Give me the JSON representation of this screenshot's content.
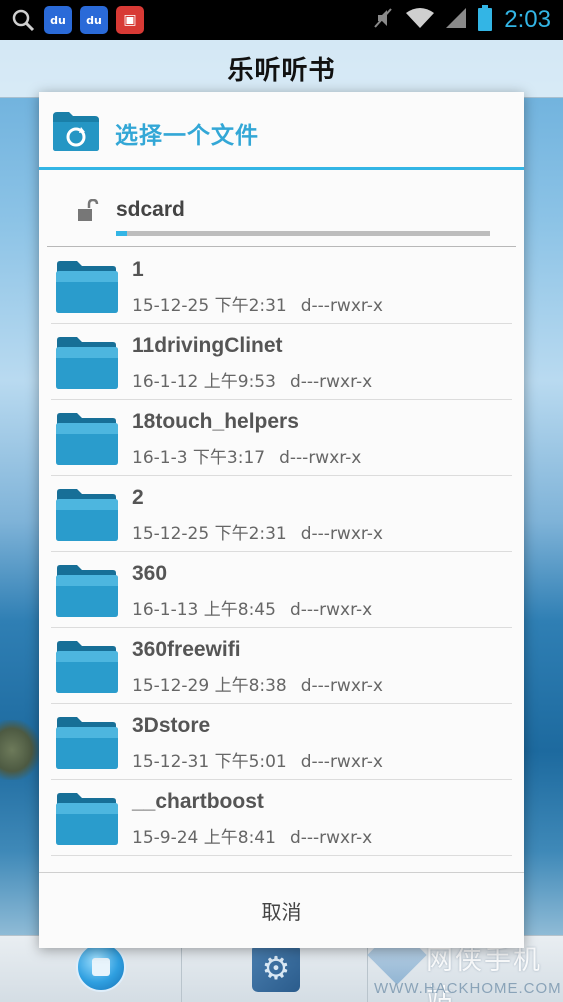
{
  "status_bar": {
    "time": "2:03",
    "left_icons": [
      "search-icon",
      "baidu-paw-icon",
      "baidu-paw-icon",
      "red-app-icon"
    ],
    "right_icons": [
      "mute-icon",
      "wifi-icon",
      "signal-icon",
      "battery-icon"
    ]
  },
  "app": {
    "title": "乐听听书"
  },
  "dialog": {
    "title": "选择一个文件",
    "path": "sdcard",
    "path_scroll_fraction": 0.03,
    "accent_color": "#33b5e5",
    "files": [
      {
        "name": "1",
        "date": "15-12-25 下午2:31",
        "perm": "d---rwxr-x"
      },
      {
        "name": "11drivingClinet",
        "date": "16-1-12 上午9:53",
        "perm": "d---rwxr-x"
      },
      {
        "name": "18touch_helpers",
        "date": "16-1-3 下午3:17",
        "perm": "d---rwxr-x"
      },
      {
        "name": "2",
        "date": "15-12-25 下午2:31",
        "perm": "d---rwxr-x"
      },
      {
        "name": "360",
        "date": "16-1-13 上午8:45",
        "perm": "d---rwxr-x"
      },
      {
        "name": "360freewifi",
        "date": "15-12-29 上午8:38",
        "perm": "d---rwxr-x"
      },
      {
        "name": "3Dstore",
        "date": "15-12-31 下午5:01",
        "perm": "d---rwxr-x"
      },
      {
        "name": "__chartboost",
        "date": "15-9-24 上午8:41",
        "perm": "d---rwxr-x"
      }
    ],
    "cancel_label": "取消"
  },
  "watermark": {
    "cn": "网侠手机站",
    "en": "WWW.HACKHOME.COM"
  }
}
